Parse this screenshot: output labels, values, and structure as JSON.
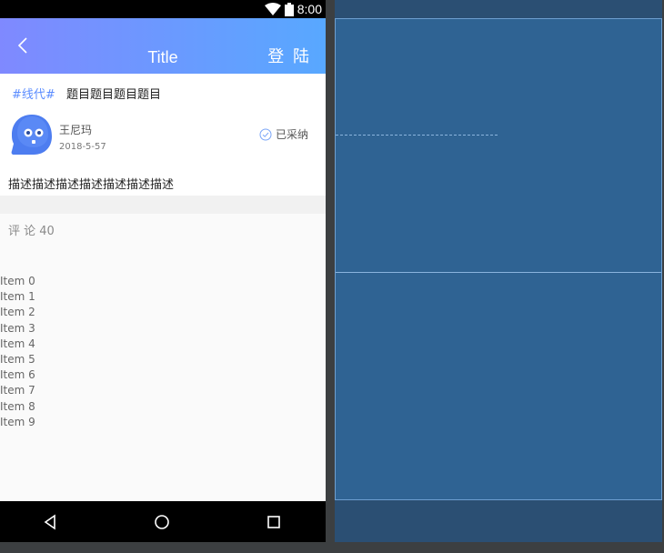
{
  "status_bar": {
    "time": "8:00"
  },
  "app_bar": {
    "title": "Title",
    "login_label": "登 陆"
  },
  "question": {
    "tag": "#线代#",
    "title": "题目题目题目题目",
    "author_name": "王尼玛",
    "date": "2018-5-57",
    "adopted_label": "已采纳",
    "description": "描述描述描述描述描述描述描述"
  },
  "comments": {
    "count_label": "评 论 40",
    "items": [
      "Item 0",
      "Item 1",
      "Item 2",
      "Item 3",
      "Item 4",
      "Item 5",
      "Item 6",
      "Item 7",
      "Item 8",
      "Item 9"
    ]
  },
  "colors": {
    "appbar_gradient_start": "#7f89ff",
    "appbar_gradient_end": "#58a8ff",
    "accent": "#5b8cff",
    "blueprint_bg": "#2f6393"
  },
  "icons": {
    "back": "chevron-left-icon",
    "wifi": "wifi-icon",
    "battery": "battery-icon",
    "adopted": "check-circle-icon",
    "nav_back": "triangle-back-icon",
    "nav_home": "circle-home-icon",
    "nav_recent": "square-recent-icon"
  }
}
